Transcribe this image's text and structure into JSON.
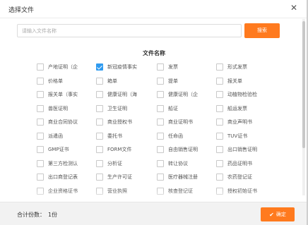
{
  "dialog": {
    "title": "选择文件",
    "close_icon": "close-icon"
  },
  "search": {
    "placeholder": "请输入文件名称",
    "button_label": "搜索"
  },
  "table": {
    "column_header": "文件名称",
    "items": [
      {
        "label": "产地证明（企",
        "checked": false
      },
      {
        "label": "新冠疫情事实",
        "checked": true
      },
      {
        "label": "发票",
        "checked": false
      },
      {
        "label": "形式发票",
        "checked": false
      },
      {
        "label": "价格单",
        "checked": false
      },
      {
        "label": "箱单",
        "checked": false
      },
      {
        "label": "提单",
        "checked": false
      },
      {
        "label": "报关单",
        "checked": false
      },
      {
        "label": "报关单（事实",
        "checked": false
      },
      {
        "label": "健康证明（海",
        "checked": false
      },
      {
        "label": "健康证明（企",
        "checked": false
      },
      {
        "label": "动植物检验检",
        "checked": false
      },
      {
        "label": "兽医证明",
        "checked": false
      },
      {
        "label": "卫生证明",
        "checked": false
      },
      {
        "label": "船证",
        "checked": false
      },
      {
        "label": "船运发票",
        "checked": false
      },
      {
        "label": "商业合同协议",
        "checked": false
      },
      {
        "label": "商业授权书",
        "checked": false
      },
      {
        "label": "商业证明书",
        "checked": false
      },
      {
        "label": "商业声明书",
        "checked": false
      },
      {
        "label": "派遣函",
        "checked": false
      },
      {
        "label": "委托书",
        "checked": false
      },
      {
        "label": "任命函",
        "checked": false
      },
      {
        "label": "TUV证书",
        "checked": false
      },
      {
        "label": "GMP证书",
        "checked": false
      },
      {
        "label": "FORM文件",
        "checked": false
      },
      {
        "label": "自由销售证明",
        "checked": false
      },
      {
        "label": "出口销售证明",
        "checked": false
      },
      {
        "label": "第三方检测认",
        "checked": false
      },
      {
        "label": "分析证",
        "checked": false
      },
      {
        "label": "转让协议",
        "checked": false
      },
      {
        "label": "药品证明书",
        "checked": false
      },
      {
        "label": "出口商登记表",
        "checked": false
      },
      {
        "label": "生产许可证",
        "checked": false
      },
      {
        "label": "医疗器械注册",
        "checked": false
      },
      {
        "label": "农药登记证",
        "checked": false
      },
      {
        "label": "企业资格证书",
        "checked": false
      },
      {
        "label": "营业执照",
        "checked": false
      },
      {
        "label": "核查登记证",
        "checked": false
      },
      {
        "label": "授权初始证书",
        "checked": false
      }
    ]
  },
  "footer": {
    "total_label": "合计份数：",
    "total_value": "1份",
    "confirm_label": "确定"
  }
}
